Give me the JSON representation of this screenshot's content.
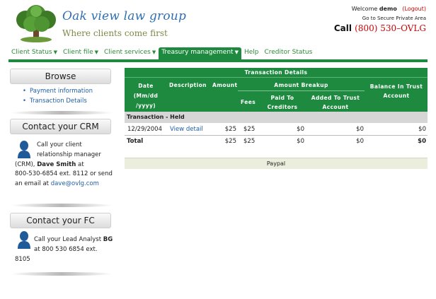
{
  "header": {
    "brand_name": "Oak view law group",
    "tagline": "Where clients come first",
    "welcome_prefix": "Welcome",
    "username": "demo",
    "logout": "(Logout)",
    "secure_link": "Go to Secure Private Area",
    "call_label": "Call",
    "phone": "(800) 530–OVLG"
  },
  "nav": {
    "items": [
      {
        "label": "Client Status",
        "caret": "▼"
      },
      {
        "label": "Client file",
        "caret": "▼"
      },
      {
        "label": "Client services",
        "caret": "▼"
      },
      {
        "label": "Treasury management",
        "caret": "▼"
      },
      {
        "label": "Help",
        "caret": ""
      },
      {
        "label": "Creditor Status",
        "caret": ""
      }
    ],
    "active_index": 3
  },
  "sidebar": {
    "browse_title": "Browse",
    "browse_links": [
      "Payment information",
      "Transaction Details"
    ],
    "crm_title": "Contact your CRM",
    "crm_line1": "Call your client",
    "crm_line2": "relationship manager",
    "crm_line3_prefix": "(CRM),",
    "crm_name": "Dave Smith",
    "crm_line3_suffix": "at",
    "crm_line4": "800-530-6854 ext. 8112 or send",
    "crm_line5_prefix": "an email at",
    "crm_email": "dave@ovlg.com",
    "fc_title": "Contact your FC",
    "fc_line1_prefix": "Call your Lead Analyst",
    "fc_name": "BG",
    "fc_line2": "at 800 530 6854 ext.",
    "fc_line3": "8105"
  },
  "table": {
    "caption": "Transaction Details",
    "col_date_1": "Date",
    "col_date_2": "(Mm/dd",
    "col_date_3": "/yyyy)",
    "col_description": "Description",
    "col_amount": "Amount",
    "col_breakup": "Amount Breakup",
    "col_fees": "Fees",
    "col_paid_1": "Paid To",
    "col_paid_2": "Creditors",
    "col_trust_1": "Added To Trust",
    "col_trust_2": "Account",
    "col_balance_1": "Balance In Trust",
    "col_balance_2": "Account",
    "section_label": "Transaction - Held",
    "rows": [
      {
        "date": "12/29/2004",
        "description": "View detail",
        "amount": "$25",
        "fees": "$25",
        "paid": "$0",
        "added": "$0",
        "balance": "$0"
      }
    ],
    "total": {
      "label": "Total",
      "amount": "$25",
      "fees": "$25",
      "paid": "$0",
      "added": "$0",
      "balance": "$0"
    },
    "footer": "Paypal"
  },
  "colors": {
    "green": "#1e8a3f",
    "link": "#1d5fa8",
    "red": "#cc0000"
  },
  "icons": {
    "logo": "oak-tree-logo",
    "person": "person-silhouette-icon"
  }
}
